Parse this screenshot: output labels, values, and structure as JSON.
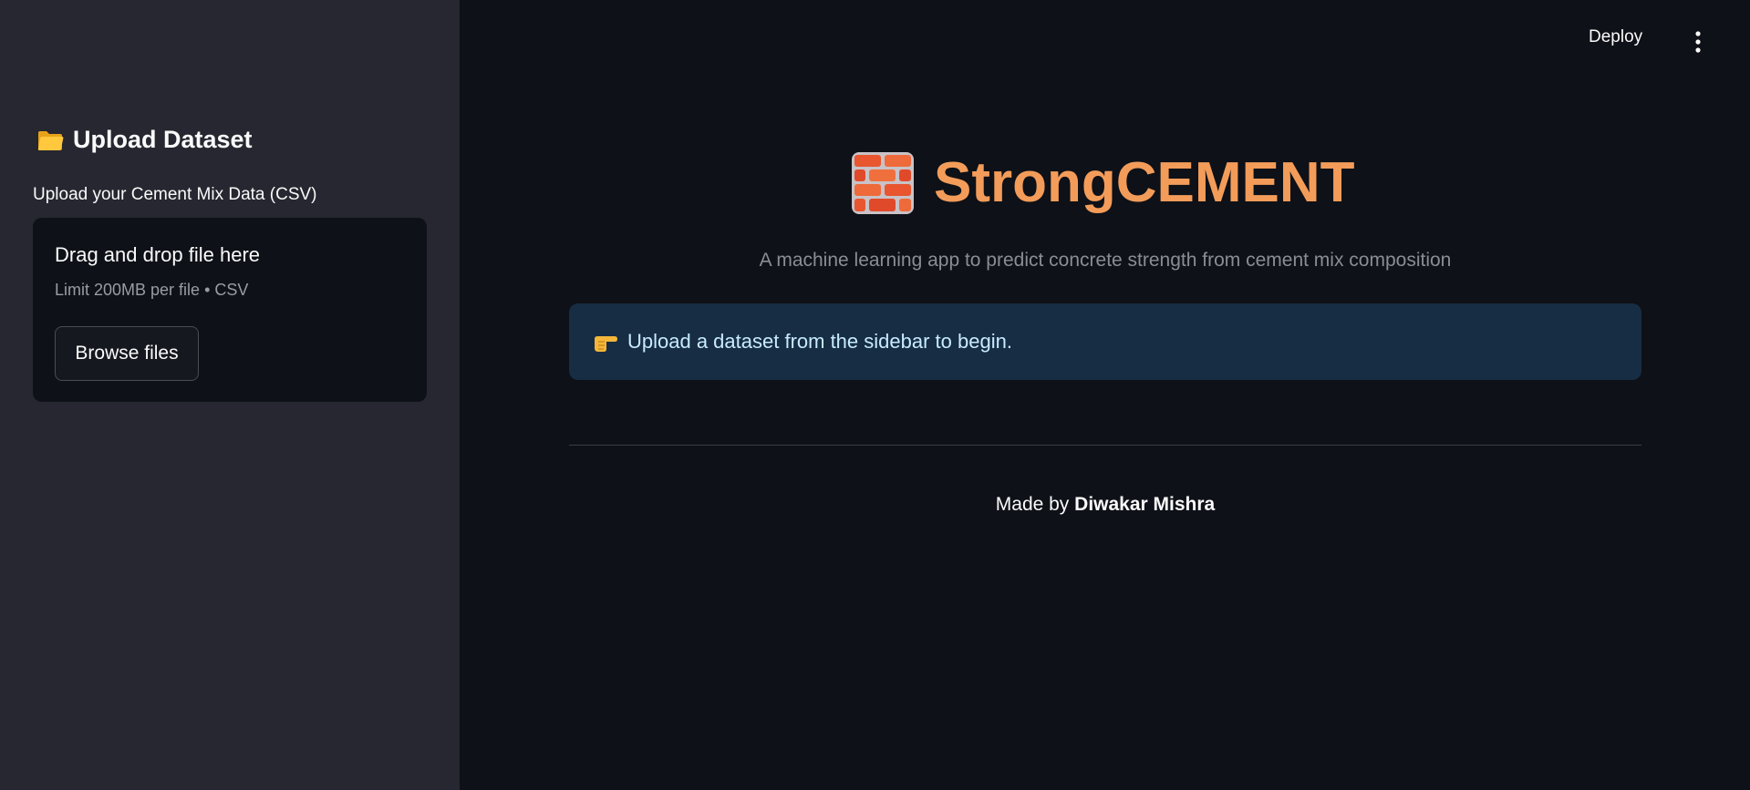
{
  "sidebar": {
    "header": "Upload Dataset",
    "header_icon": "folder-icon",
    "uploader": {
      "label": "Upload your Cement Mix Data (CSV)",
      "drop_title": "Drag and drop file here",
      "limit_text": "Limit 200MB per file • CSV",
      "browse_label": "Browse files"
    }
  },
  "toolbar": {
    "deploy_label": "Deploy",
    "menu_icon": "more-vertical-icon"
  },
  "main": {
    "title_icon": "brick-icon",
    "title": "StrongCEMENT",
    "subtitle": "A machine learning app to predict concrete strength from cement mix composition",
    "info": {
      "icon": "pointing-hand-icon",
      "text": "Upload a dataset from the sidebar to begin."
    },
    "footer": {
      "prefix": "Made by ",
      "author": "Diwakar Mishra"
    }
  },
  "colors": {
    "background": "#0e1117",
    "sidebar": "#262730",
    "accent": "#f39c5a",
    "info_bg": "#172d43",
    "info_text": "#c7ebff"
  }
}
